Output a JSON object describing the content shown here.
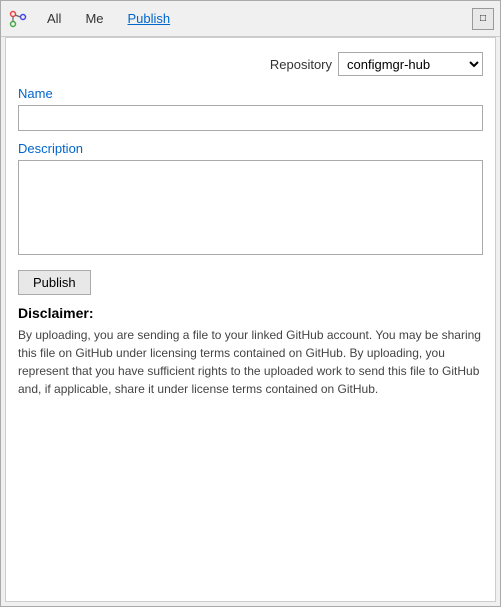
{
  "tabs": {
    "all_label": "All",
    "me_label": "Me",
    "publish_label": "Publish"
  },
  "window_controls": {
    "restore_label": "□"
  },
  "form": {
    "repo_label": "Repository",
    "repo_selected": "configmgr-hub",
    "repo_options": [
      "configmgr-hub"
    ],
    "name_label": "Name",
    "name_placeholder": "",
    "description_label": "Description",
    "description_placeholder": "",
    "publish_button": "Publish"
  },
  "disclaimer": {
    "title": "Disclaimer:",
    "text": "By uploading, you are sending a file to your linked GitHub account. You may be sharing this file on GitHub under licensing terms contained on GitHub. By uploading, you represent that you have sufficient rights to the uploaded work to send this file to GitHub and, if applicable, share it under license terms contained on GitHub."
  }
}
